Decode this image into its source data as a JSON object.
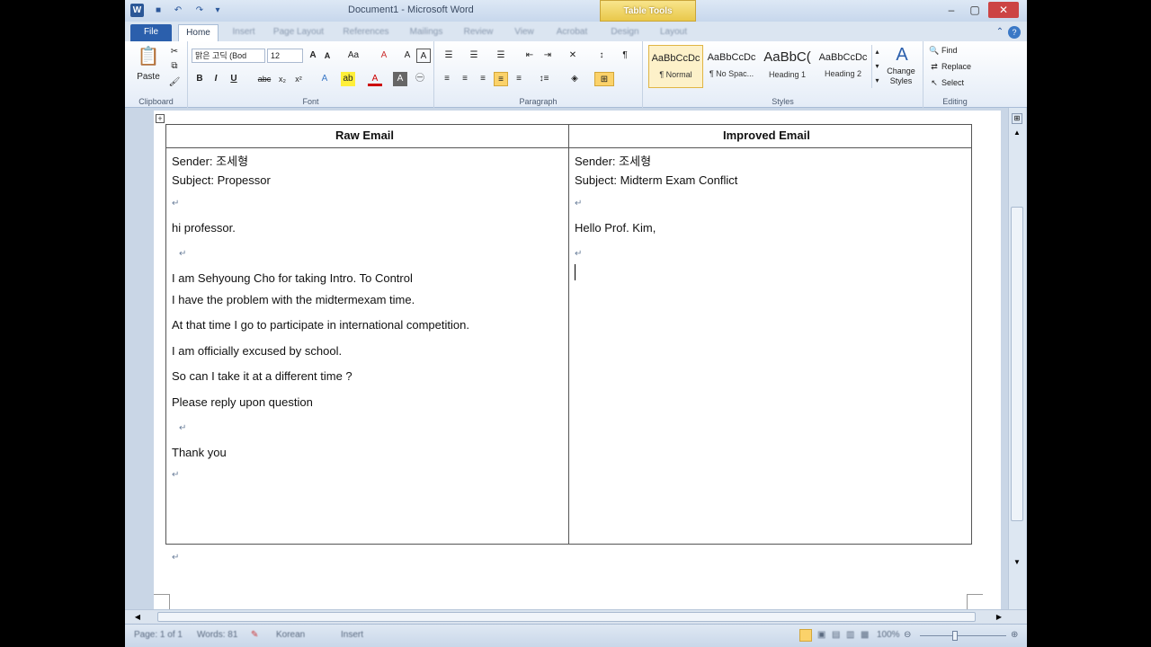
{
  "window": {
    "title": "Document1 - Microsoft Word",
    "context_tab_group": "Table Tools"
  },
  "tabs": [
    "File",
    "Home",
    "Insert",
    "Page Layout",
    "References",
    "Mailings",
    "Review",
    "View",
    "Acrobat",
    "Design",
    "Layout"
  ],
  "ribbon": {
    "clipboard": {
      "label": "Clipboard",
      "paste": "Paste"
    },
    "font": {
      "label": "Font",
      "family": "맑은 고딕 (Bod",
      "size": "12"
    },
    "paragraph": {
      "label": "Paragraph"
    },
    "styles": {
      "label": "Styles",
      "items": [
        {
          "sample": "AaBbCcDc",
          "name": "¶ Normal"
        },
        {
          "sample": "AaBbCcDc",
          "name": "¶ No Spac..."
        },
        {
          "sample": "AaBbC(",
          "name": "Heading 1"
        },
        {
          "sample": "AaBbCcDc",
          "name": "Heading 2"
        }
      ],
      "change_styles": "Change Styles"
    },
    "editing": {
      "label": "Editing",
      "find": "Find",
      "replace": "Replace",
      "select": "Select"
    }
  },
  "document": {
    "table": {
      "headers": [
        "Raw Email",
        "Improved Email"
      ],
      "raw_email": [
        "Sender:  조세형",
        "Subject: Propessor",
        "",
        "hi professor.",
        "",
        "I am Sehyoung Cho for taking Intro. To Control",
        "I have the problem with the midtermexam time.",
        "At that time I go to participate in international competition.",
        "I am officially excused by school.",
        "So can I take it at a different time ?",
        "Please reply upon question",
        "",
        "Thank you",
        ""
      ],
      "improved_email": [
        "Sender:  조세형",
        "Subject: Midterm Exam Conflict",
        "",
        "Hello Prof. Kim,",
        "",
        ""
      ]
    }
  },
  "status_bar": {
    "page": "Page: 1 of 1",
    "words": "Words: 81",
    "language": "Korean",
    "mode": "Insert",
    "zoom": "100%"
  }
}
